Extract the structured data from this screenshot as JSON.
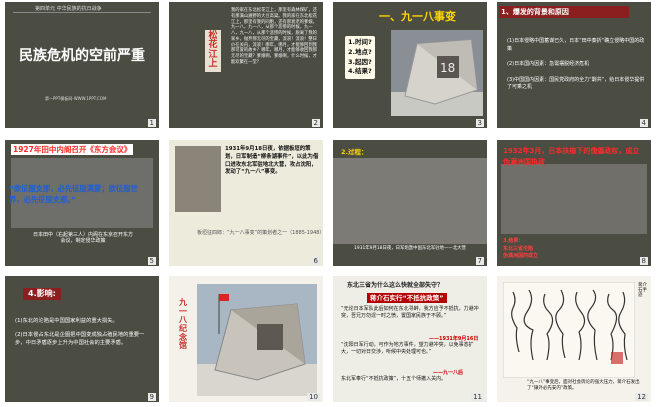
{
  "slides": [
    {
      "num": "1",
      "header": "第四单元  中华民族的抗日战争",
      "title": "民族危机的空前严重",
      "footer": "第一PPT模板网-WWW.1PPT.COM"
    },
    {
      "num": "2",
      "vertical": "松花江上",
      "poem": "我的家在东北松花江上，那里有森林煤矿，还有那满山遍野的大豆高粱。我的家在东北松花江上，那里有我的同胞，还有那衰老的爹娘。九一八，九一八，从那个悲惨的时候，九一八，九一八，从那个悲惨的时候，脱离了我的家乡，抛弃那无尽的宝藏，流浪！流浪！整日价在关内，流浪！哪年，哪月，才能够回到我那可爱的故乡？哪年，哪月，才能够收回我那无尽的宝藏？爹娘啊，爹娘啊，什么时候，才能欢聚在一堂？"
    },
    {
      "num": "3",
      "title": "一、九一八事变",
      "questions": [
        "1.时间?",
        "2.地点?",
        "3.起因?",
        "4.结果?"
      ],
      "monument_label": "18"
    },
    {
      "num": "4",
      "heading": "1、爆发的背景和原因",
      "items": [
        "(1)日本侵略中国蓄谋已久，日本“田中奏折”确立侵略中国的政策",
        "(2)日本国内因素：急需摆脱经济危机",
        "(3)中国国内因素：国民党政府的全力“剿共”，给日本侵华提供了可乘之机"
      ]
    },
    {
      "num": "5",
      "title": "1927年田中内阁召开《东方会议》",
      "blue_text": "“欲征服支那，必先征服满蒙；欲征服世界，必先征服支那。”",
      "caption": "日本田中（右起第三人）内阁在东京召开东方会议，制定侵华政策"
    },
    {
      "num": "6",
      "text": "1931年9月18日夜，依据板垣的策划，日军制造“柳条湖事件”，以此为借口进攻东北军驻地北大营，攻占沈阳，发动了“九一八”事变。",
      "caption": "板垣征四郎：“九一八事变”的策划者之一（1885-1948）"
    },
    {
      "num": "7",
      "label": "2.过程：",
      "caption": "1931年9月18日夜，日军炮轰中国东北军驻地——北大营"
    },
    {
      "num": "8",
      "title": "1932年3月，日本扶植下的傀儡政权，成立伪满洲国执政",
      "red_text": "3.结果：\n东北三省沦陷\n伪满洲国的成立"
    },
    {
      "num": "9",
      "heading": "4.影响:",
      "items": [
        "(1)东北的沦陷是中国国家利益的重大损失。",
        "(2)日本侵占东北是企图把中国变成独占殖民地的重要一步，中日矛盾逐步上升为中国社会的主要矛盾。"
      ]
    },
    {
      "num": "10",
      "vertical": "九一八纪念馆"
    },
    {
      "num": "11",
      "question": "东北三省为什么这么快就全部失守？",
      "heading": "蒋介石实行“不抵抗政策”",
      "body1": "“无论日本军队此后如何在东北寻衅，我方应予不抵抗，力避冲突，吾兄万勿逞一时之愤，置国家民族于不顾。”",
      "date1": "——1931年9月16日",
      "body2": "“沈阳日军行动，可作为地方事件，望力避冲突，以免事态扩大，一切对日交涉，听候中央处理可也。”",
      "date2": "——九一八后",
      "body3": "东北军奉行“不抵抗政策”，十五个师撤入关内。"
    },
    {
      "num": "12",
      "caption": "“九一八”事变后，面对社会舆论的强大压力，蒋介石发出了“攘外必先安内”政策。",
      "side": "蒋介石手迹"
    }
  ]
}
